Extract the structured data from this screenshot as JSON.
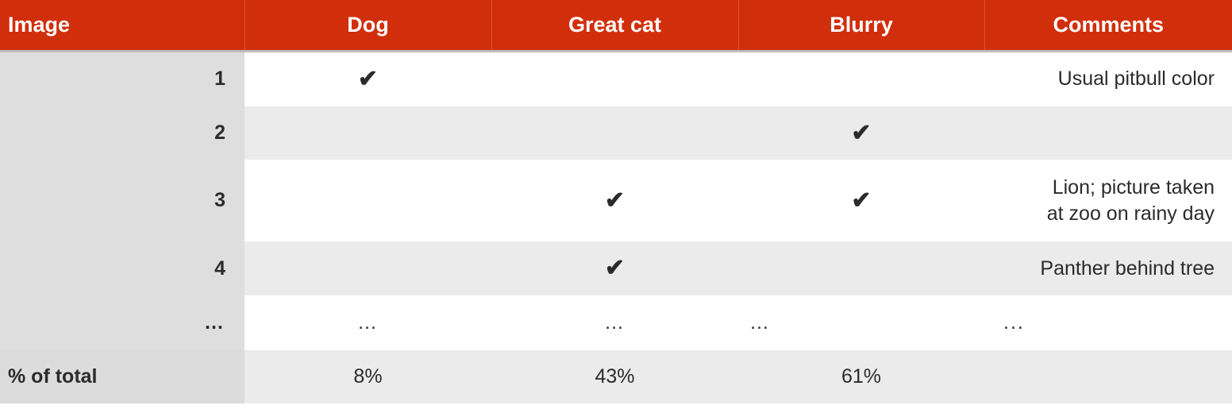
{
  "table": {
    "columns": [
      {
        "key": "image",
        "label": "Image"
      },
      {
        "key": "dog",
        "label": "Dog"
      },
      {
        "key": "greatcat",
        "label": "Great cat"
      },
      {
        "key": "blurry",
        "label": "Blurry"
      },
      {
        "key": "comments",
        "label": "Comments"
      }
    ],
    "check_glyph": "✔",
    "ellipsis": "…",
    "ellipsis_comments": "...",
    "rows": [
      {
        "index": "1",
        "dog": "✔",
        "greatcat": "",
        "blurry": "",
        "comments": "Usual pitbull color"
      },
      {
        "index": "2",
        "dog": "",
        "greatcat": "",
        "blurry": "✔",
        "comments": ""
      },
      {
        "index": "3",
        "dog": "",
        "greatcat": "✔",
        "blurry": "✔",
        "comments": "Lion; picture taken\nat zoo on rainy day"
      },
      {
        "index": "4",
        "dog": "",
        "greatcat": "✔",
        "blurry": "",
        "comments": "Panther behind tree"
      },
      {
        "index": "…",
        "dog": "…",
        "greatcat": "…",
        "blurry": "…",
        "comments": "..."
      }
    ],
    "total_row": {
      "label": "% of total",
      "dog": "8%",
      "greatcat": "43%",
      "blurry": "61%",
      "comments": ""
    },
    "colors": {
      "header_bg": "#d12f0c",
      "header_text": "#ffffff",
      "row_odd_bg": "#ffffff",
      "row_even_bg": "#ebebeb",
      "index_col_bg": "#dedede",
      "total_row_bg": "#ebebeb",
      "body_text": "#2b2b2b",
      "header_divider": "#dc5433",
      "header_rule": "#bdbdbd"
    }
  }
}
